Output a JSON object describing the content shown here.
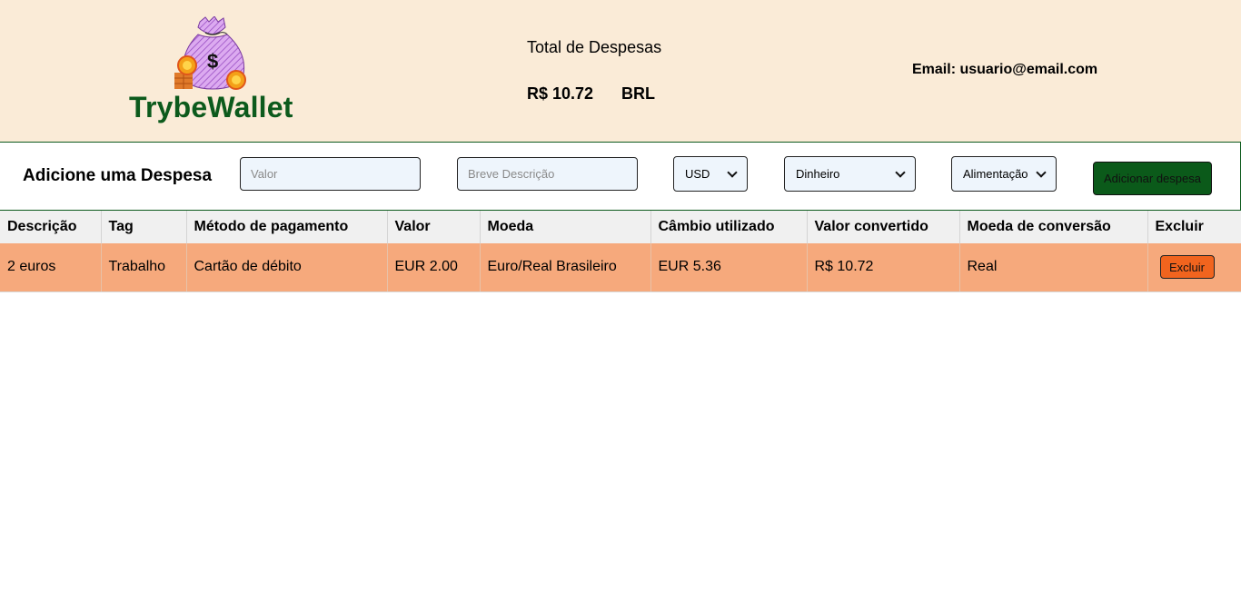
{
  "header": {
    "brand": "TrybeWallet",
    "total_label": "Total de Despesas",
    "total_value": "R$ 10.72",
    "total_currency": "BRL",
    "email_text": "Email: usuario@email.com"
  },
  "form": {
    "title": "Adicione uma Despesa",
    "value_placeholder": "Valor",
    "description_placeholder": "Breve Descrição",
    "currency_selected": "USD",
    "method_selected": "Dinheiro",
    "tag_selected": "Alimentação",
    "add_button": "Adicionar despesa"
  },
  "table": {
    "headers": [
      "Descrição",
      "Tag",
      "Método de pagamento",
      "Valor",
      "Moeda",
      "Câmbio utilizado",
      "Valor convertido",
      "Moeda de conversão",
      "Excluir"
    ],
    "rows": [
      {
        "description": "2 euros",
        "tag": "Trabalho",
        "method": "Cartão de débito",
        "value": "EUR 2.00",
        "currency": "Euro/Real Brasileiro",
        "exchange": "EUR 5.36",
        "converted": "R$ 10.72",
        "conversion_currency": "Real",
        "delete_label": "Excluir"
      }
    ]
  },
  "colors": {
    "header_bg": "#faebd7",
    "brand": "#0c5a1c",
    "row_bg": "#f6a97c",
    "delete_button": "#f1641e",
    "add_button": "#0b5a1a"
  },
  "icons": {
    "logo": "money-bag-icon"
  }
}
